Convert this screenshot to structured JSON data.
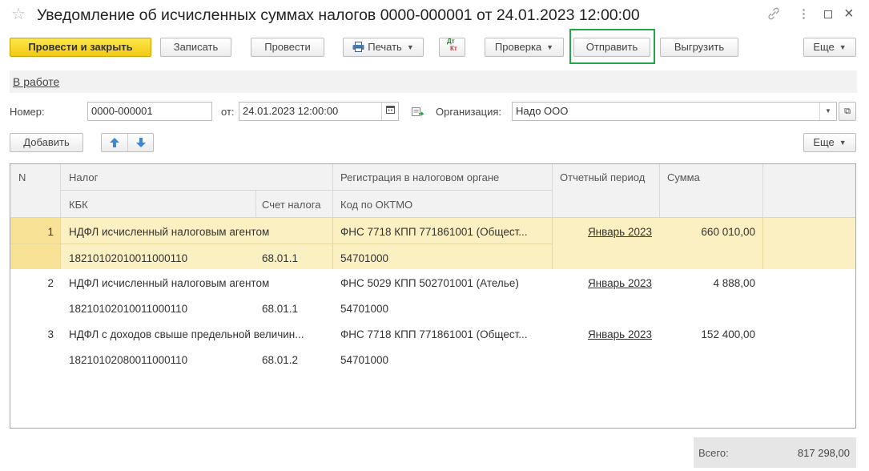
{
  "window": {
    "title": "Уведомление об исчисленных суммах налогов 0000-000001 от 24.01.2023 12:00:00",
    "icons": [
      "star-icon",
      "link-icon",
      "more-vertical-icon",
      "maximize-icon",
      "close-icon"
    ],
    "close_glyph": "×"
  },
  "toolbar": {
    "post_close": "Провести и закрыть",
    "write": "Записать",
    "post": "Провести",
    "print": "Печать",
    "dtkt_top": "Дт",
    "dtkt_bottom": "Кт",
    "check": "Проверка",
    "send": "Отправить",
    "export": "Выгрузить",
    "more": "Еще"
  },
  "status": {
    "label": "В работе"
  },
  "form": {
    "number_label": "Номер:",
    "number_value": "0000-000001",
    "date_label": "от:",
    "date_value": "24.01.2023 12:00:00",
    "org_label": "Организация:",
    "org_value": "Надо ООО"
  },
  "table_toolbar": {
    "add": "Добавить",
    "more": "Еще"
  },
  "table": {
    "headers": {
      "n": "N",
      "tax": "Налог",
      "kbk": "КБК",
      "account": "Счет налога",
      "registration": "Регистрация в налоговом органе",
      "oktmo": "Код по ОКТМО",
      "period": "Отчетный период",
      "sum": "Сумма"
    },
    "rows": [
      {
        "n": "1",
        "tax": "НДФЛ исчисленный налоговым агентом",
        "kbk": "18210102010011000110",
        "account": "68.01.1",
        "registration": "ФНС 7718 КПП 771861001 (Общест...",
        "oktmo": "54701000",
        "period": "Январь 2023",
        "sum": "660 010,00"
      },
      {
        "n": "2",
        "tax": "НДФЛ исчисленный налоговым агентом",
        "kbk": "18210102010011000110",
        "account": "68.01.1",
        "registration": "ФНС 5029 КПП 502701001 (Ателье)",
        "oktmo": "54701000",
        "period": "Январь 2023",
        "sum": "4 888,00"
      },
      {
        "n": "3",
        "tax": "НДФЛ с доходов свыше предельной величин...",
        "kbk": "18210102080011000110",
        "account": "68.01.2",
        "registration": "ФНС 7718 КПП 771861001 (Общест...",
        "oktmo": "54701000",
        "period": "Январь 2023",
        "sum": "152 400,00"
      }
    ]
  },
  "footer": {
    "total_label": "Всего:",
    "total_value": "817 298,00"
  },
  "colors": {
    "accent": "#f3c914",
    "highlight_frame": "#21a74a",
    "selected_row": "#fbf0c1"
  }
}
